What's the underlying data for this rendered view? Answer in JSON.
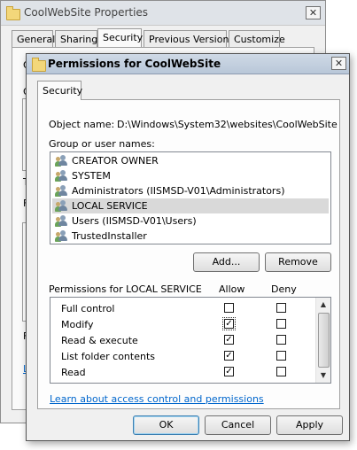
{
  "background_window": {
    "title": "CoolWebSite Properties",
    "tabs": [
      "General",
      "Sharing",
      "Security",
      "Previous Versions",
      "Customize"
    ],
    "active_tab": "Security",
    "stub_letters": [
      "O",
      "G",
      "T",
      "F",
      "F",
      "L"
    ]
  },
  "dialog": {
    "title": "Permissions for CoolWebSite",
    "tab": "Security",
    "object_name_label": "Object name:",
    "object_name_value": "D:\\Windows\\System32\\websites\\CoolWebSite",
    "group_label": "Group or user names:",
    "users": [
      {
        "name": "CREATOR OWNER",
        "selected": false
      },
      {
        "name": "SYSTEM",
        "selected": false
      },
      {
        "name": "Administrators (IISMSD-V01\\Administrators)",
        "selected": false
      },
      {
        "name": "LOCAL SERVICE",
        "selected": true
      },
      {
        "name": "Users (IISMSD-V01\\Users)",
        "selected": false
      },
      {
        "name": "TrustedInstaller",
        "selected": false
      }
    ],
    "add_label": "Add...",
    "remove_label": "Remove",
    "permissions_label": "Permissions for LOCAL SERVICE",
    "allow_header": "Allow",
    "deny_header": "Deny",
    "permissions": [
      {
        "name": "Full control",
        "allow": false,
        "deny": false
      },
      {
        "name": "Modify",
        "allow": true,
        "deny": false
      },
      {
        "name": "Read & execute",
        "allow": true,
        "deny": false
      },
      {
        "name": "List folder contents",
        "allow": true,
        "deny": false
      },
      {
        "name": "Read",
        "allow": true,
        "deny": false
      }
    ],
    "learn_link": "Learn about access control and permissions",
    "ok_label": "OK",
    "cancel_label": "Cancel",
    "apply_label": "Apply",
    "bg_link_letter": "L"
  }
}
